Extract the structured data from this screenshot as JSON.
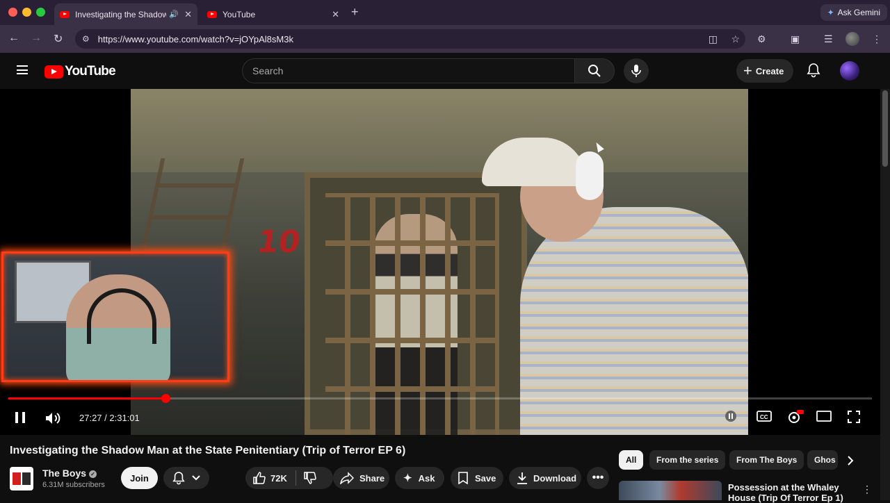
{
  "browser": {
    "tabs": [
      {
        "title": "Investigating the Shadow",
        "active": true,
        "audio": true
      },
      {
        "title": "YouTube",
        "active": false
      }
    ],
    "new_tab_label": "+",
    "ask_gemini": "Ask Gemini",
    "url": "https://www.youtube.com/watch?v=jOYpAl8sM3k"
  },
  "youtube": {
    "logo_text": "YouTube",
    "search_placeholder": "Search",
    "create_label": "Create",
    "accent": "#ff0000"
  },
  "player": {
    "time_current": "27:27",
    "time_total": "2:31:01",
    "time_display": "27:27 / 2:31:01",
    "progress_fraction": 0.182,
    "door_number": "10",
    "state": "playing"
  },
  "video": {
    "title": "Investigating the Shadow Man at the State Penitentiary (Trip of Terror EP 6)",
    "channel_name": "The Boys",
    "subscribers": "6.31M subscribers",
    "join_label": "Join",
    "likes": "72K",
    "share_label": "Share",
    "ask_label": "Ask",
    "save_label": "Save",
    "download_label": "Download"
  },
  "chips": [
    "All",
    "From the series",
    "From The Boys",
    "Ghos"
  ],
  "recommendation": {
    "title": "Possession at the Whaley House (Trip Of Terror Ep 1)"
  }
}
